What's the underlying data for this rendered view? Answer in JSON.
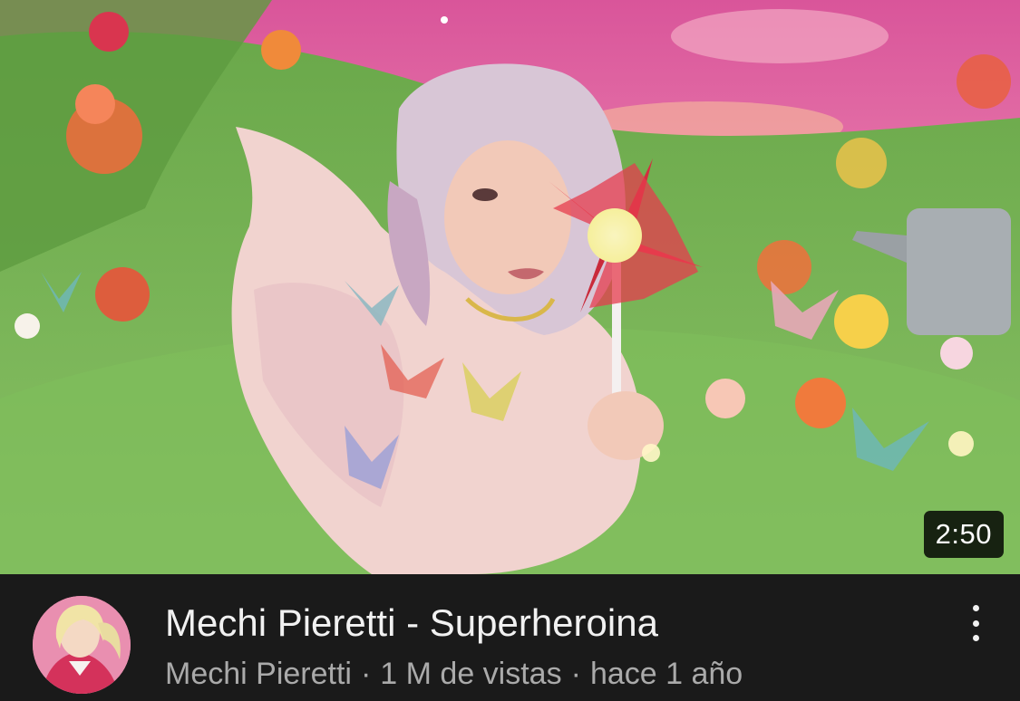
{
  "video": {
    "title": "Mechi Pieretti - Superheroina",
    "channel": "Mechi Pieretti",
    "views": "1 M de vistas",
    "age": "hace 1 año",
    "separator": "·",
    "duration": "2:50"
  },
  "thumbnail": {
    "icon": "video-thumbnail",
    "sky_color": "#ee86b4",
    "grass_color": "#7cb85a",
    "pinwheel_color": "#e8384a"
  },
  "avatar": {
    "icon": "channel-avatar",
    "color": "#e98fb0"
  },
  "menu": {
    "icon": "more-vertical-icon"
  }
}
